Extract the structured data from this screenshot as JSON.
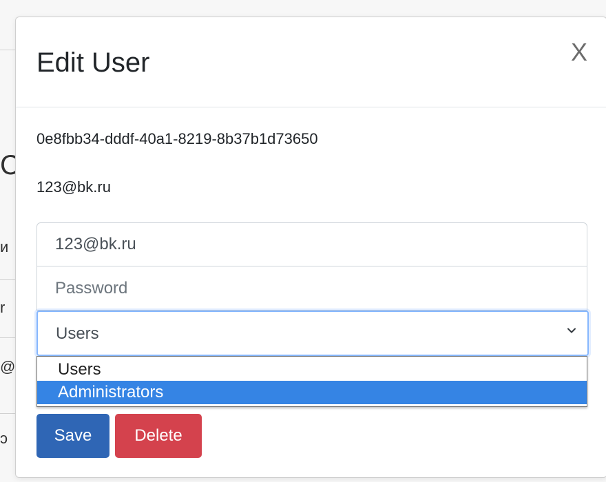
{
  "background_page": {
    "fragments": [
      "С",
      "и",
      "r",
      "@",
      "ɔ"
    ]
  },
  "modal": {
    "title": "Edit User",
    "close_label": "X",
    "user_id": "0e8fbb34-dddf-40a1-8219-8b37b1d73650",
    "user_email": "123@bk.ru",
    "form": {
      "email_value": "123@bk.ru",
      "password_value": "",
      "password_placeholder": "Password",
      "role_selected": "Users",
      "role_options": [
        "Users",
        "Administrators"
      ],
      "role_highlighted": "Administrators"
    },
    "buttons": {
      "save_label": "Save",
      "delete_label": "Delete"
    }
  },
  "colors": {
    "primary": "#2f66b5",
    "danger": "#d4424d",
    "highlight": "#3584e4",
    "focus_border": "#86b7fe"
  },
  "icons": {
    "close": "close-icon",
    "select_chevron": "chevron-down-icon"
  }
}
